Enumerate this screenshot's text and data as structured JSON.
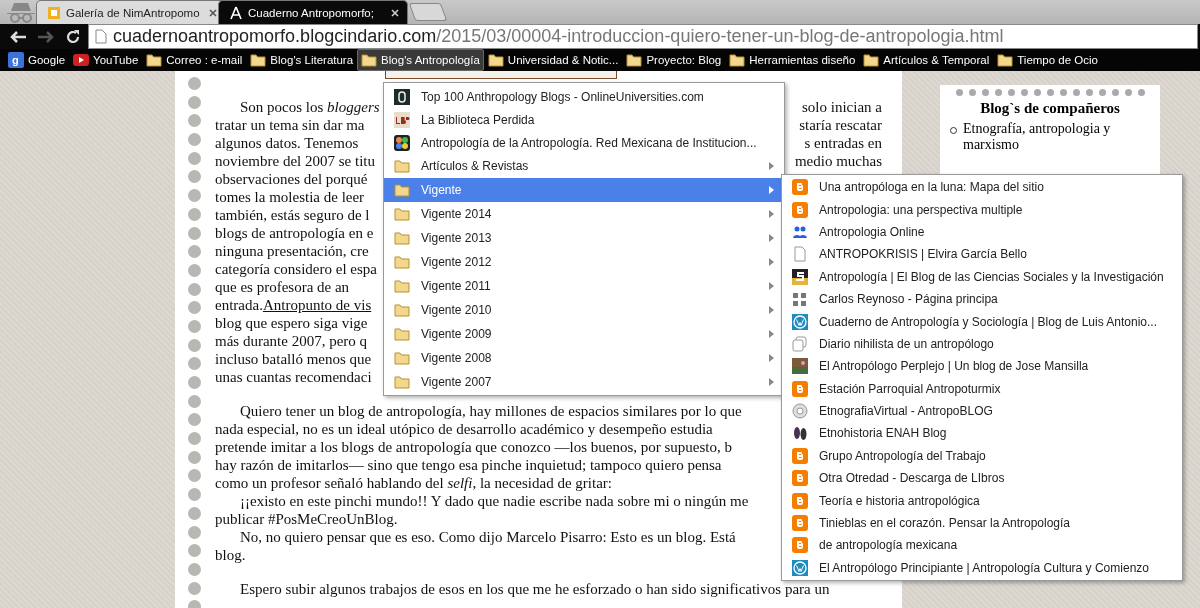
{
  "tabs": [
    {
      "title": "Galería de NimAntropomo",
      "selected": false
    },
    {
      "title": "Cuaderno Antropomorfo;",
      "selected": true
    }
  ],
  "address": {
    "host": "cuadernoantropomorfo.blogcindario.com",
    "path": "/2015/03/00004-introduccion-quiero-tener-un-blog-de-antropologia.html"
  },
  "bookmarks": [
    {
      "label": "Google",
      "kind": "google",
      "icon_letter": "g",
      "selected": false
    },
    {
      "label": "YouTube",
      "kind": "youtube",
      "selected": false
    },
    {
      "label": "Correo : e-mail",
      "kind": "folder",
      "selected": false
    },
    {
      "label": "Blog's Literatura",
      "kind": "folder",
      "selected": false
    },
    {
      "label": "Blog's Antropología",
      "kind": "folder",
      "selected": true
    },
    {
      "label": "Universidad & Notic...",
      "kind": "folder",
      "selected": false
    },
    {
      "label": "Proyecto: Blog",
      "kind": "folder",
      "selected": false
    },
    {
      "label": "Herramientas diseño",
      "kind": "folder",
      "selected": false
    },
    {
      "label": "Artículos & Temporal",
      "kind": "folder",
      "selected": false
    },
    {
      "label": "Tiempo de Ocio",
      "kind": "folder",
      "selected": false
    }
  ],
  "article": {
    "sections": [
      [
        {
          "lines": [
            {
              "left": "Son pocos los *bloggers*",
              "right": "solo inician a"
            },
            {
              "left": "tratar un tema sin dar ma",
              "right": "staría rescatar"
            },
            {
              "left": "algunos datos. Tenemos",
              "right": "s entradas en"
            },
            {
              "left": "noviembre del 2007 se titu",
              "right": "medio muchas"
            },
            {
              "left": "observaciones del porqué"
            },
            {
              "left": "tomes la molestia de leer"
            },
            {
              "left": "también, estás seguro de l"
            },
            {
              "left": "blogs de antropología en e"
            },
            {
              "left": "ninguna presentación, cre"
            },
            {
              "left": "categoría considero el espa"
            },
            {
              "left": "que es profesora de an"
            },
            {
              "left": "entrada.",
              "link": "Antropunto de vis"
            },
            {
              "left": "blog que espero siga vige"
            },
            {
              "left": "más durante 2007, pero q"
            },
            {
              "left": "incluso batalló menos que"
            },
            {
              "left": "unas cuantas recomendaci"
            }
          ]
        }
      ],
      [
        {
          "lines": [
            {
              "left": "Quiero tener un blog de antropología, hay millones de espacios similares por lo que"
            },
            {
              "left": "nada especial, no es un ideal utópico de desarrollo académico y desempeño estudia"
            },
            {
              "left": "pretende imitar a los blogs de antropología que conozco —los buenos, por supuesto, b"
            },
            {
              "left": "hay razón de imitarlos— sino que tengo esa pinche inquietud; tampoco quiero pensa"
            },
            {
              "left": "como un profesor señaló hablando del *selfi*, la necesidad de gritar:"
            }
          ]
        },
        {
          "lines": [
            {
              "left": "¡¡existo en este pinchi mundo!! Y dado que nadie escribe nada sobre mi o ningún me"
            },
            {
              "left": "publicar #PosMeCreoUnBlog."
            }
          ]
        },
        {
          "lines": [
            {
              "left": "No, no quiero pensar que es eso. Como dijo Marcelo Pisarro: Esto es un blog. Está"
            },
            {
              "left": "blog."
            }
          ]
        }
      ],
      [
        {
          "lines": [
            {
              "left": "Espero subir algunos trabajos de esos en los que me he esforzado o han sido significativos para un"
            }
          ]
        }
      ]
    ]
  },
  "sidebar": {
    "title": "Blog`s de compañeros",
    "items": [
      "Etnografía, antropologia y marxismo"
    ]
  },
  "menu": {
    "items": [
      {
        "label": "Top 100 Anthropology Blogs - OnlineUniversities.com",
        "kind": "dark",
        "selected": false
      },
      {
        "label": "La Biblioteca Perdida",
        "kind": "lbp",
        "selected": false
      },
      {
        "label": "Antropología de la Antropología. Red Mexicana de Institucion...",
        "kind": "multicolor",
        "selected": false
      },
      {
        "label": "Artículos & Revistas",
        "kind": "folder",
        "selected": false
      },
      {
        "label": "Vigente",
        "kind": "folder",
        "selected": true
      },
      {
        "label": "Vigente 2014",
        "kind": "folder",
        "selected": false
      },
      {
        "label": "Vigente 2013",
        "kind": "folder",
        "selected": false
      },
      {
        "label": "Vigente 2012",
        "kind": "folder",
        "selected": false
      },
      {
        "label": "Vigente 2011",
        "kind": "folder",
        "selected": false
      },
      {
        "label": "Vigente 2010",
        "kind": "folder",
        "selected": false
      },
      {
        "label": "Vigente 2009",
        "kind": "folder",
        "selected": false
      },
      {
        "label": "Vigente 2008",
        "kind": "folder",
        "selected": false
      },
      {
        "label": "Vigente 2007",
        "kind": "folder",
        "selected": false
      }
    ]
  },
  "submenu": {
    "items": [
      {
        "label": "Una antropóloga en la luna: Mapa del sitio",
        "kind": "blogger"
      },
      {
        "label": "Antropologia: una perspectiva multiple",
        "kind": "blogger"
      },
      {
        "label": "Antropologia Online",
        "kind": "people"
      },
      {
        "label": "ANTROPOKRISIS | Elvira García Bello",
        "kind": "page"
      },
      {
        "label": "Antropología | El Blog de las Ciencias Sociales y la Investigación",
        "kind": "s-logo"
      },
      {
        "label": "Carlos Reynoso - Página principa",
        "kind": "grid"
      },
      {
        "label": "Cuaderno de Antropología y Sociología | Blog de Luis Antonio...",
        "kind": "wordpress"
      },
      {
        "label": "Diario nihilista de un antropólogo",
        "kind": "copy"
      },
      {
        "label": "El Antropólogo Perplejo | Un blog de Jose Mansilla",
        "kind": "photo"
      },
      {
        "label": "Estación Parroquial Antropoturmix",
        "kind": "blogger"
      },
      {
        "label": "EtnografiaVirtual - AntropoBLOG",
        "kind": "flower"
      },
      {
        "label": "Etnohistoria ENAH Blog",
        "kind": "feet"
      },
      {
        "label": "Grupo Antropología del Trabajo",
        "kind": "blogger"
      },
      {
        "label": "Otra Otredad - Descarga de LIbros",
        "kind": "blogger"
      },
      {
        "label": "Teoría e historia antropológica",
        "kind": "blogger"
      },
      {
        "label": "Tinieblas en el corazón. Pensar la Antropología",
        "kind": "blogger"
      },
      {
        "label": "de antropología mexicana",
        "kind": "blogger"
      },
      {
        "label": "El Antropólogo Principiante | Antropología Cultura y Comienzo",
        "kind": "wordpress"
      }
    ]
  }
}
